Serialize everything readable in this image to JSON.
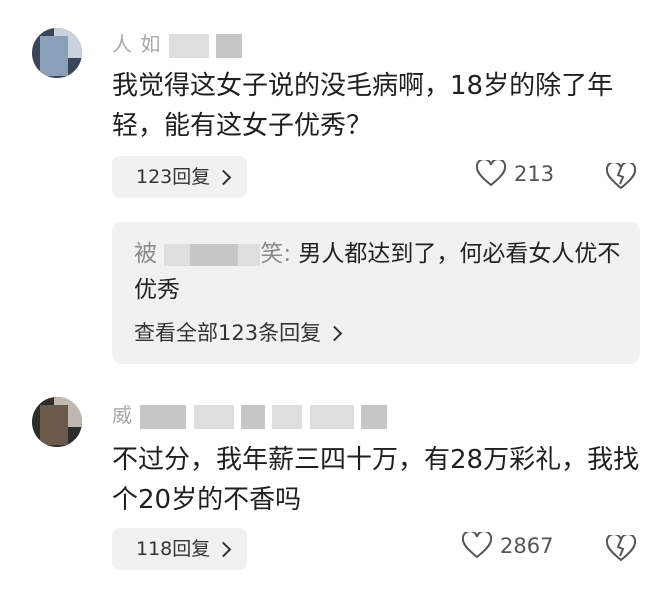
{
  "comments": [
    {
      "username_visible": "人 如",
      "text": "我觉得这女子说的没毛病啊，18岁的除了年轻，能有这女子优秀？",
      "reply_label": "123回复",
      "likes": "213",
      "sub_reply": {
        "author_visible": "被 ",
        "author_suffix": "笑:",
        "text": " 男人都达到了，何必看女人优不优秀",
        "view_all": "查看全部123条回复"
      }
    },
    {
      "username_visible": "威",
      "text": "不过分，我年薪三四十万，有28万彩礼，我找个20岁的不香吗",
      "reply_label": "118回复",
      "likes": "2867"
    }
  ],
  "icons": {
    "like": "heart-outline-icon",
    "dislike": "broken-heart-icon",
    "chevron": "chevron-right-icon"
  },
  "colors": {
    "username": "#a9a9a9",
    "pill_bg": "#f1f1f1",
    "text": "#1f1f1f"
  }
}
